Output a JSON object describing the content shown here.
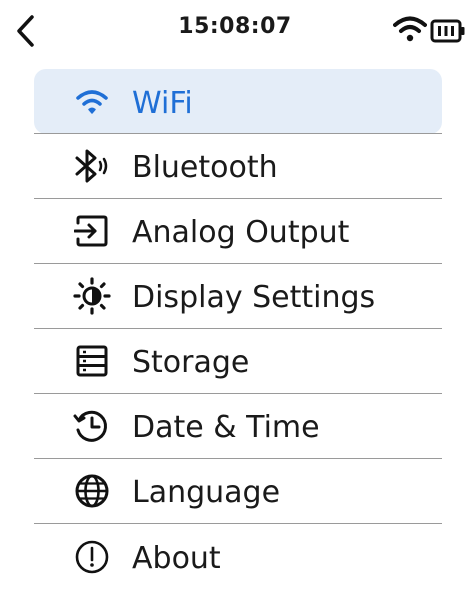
{
  "status_bar": {
    "time": "15:08:07",
    "back_icon": "chevron-left-icon",
    "wifi_icon": "wifi-icon",
    "battery_icon": "battery-icon"
  },
  "accent_color": "#1f6fd6",
  "selected_bg": "#e4edf8",
  "menu": {
    "items": [
      {
        "label": "WiFi",
        "icon": "wifi-icon",
        "selected": true
      },
      {
        "label": "Bluetooth",
        "icon": "bluetooth-icon",
        "selected": false
      },
      {
        "label": "Analog Output",
        "icon": "output-icon",
        "selected": false
      },
      {
        "label": "Display Settings",
        "icon": "brightness-icon",
        "selected": false
      },
      {
        "label": "Storage",
        "icon": "storage-icon",
        "selected": false
      },
      {
        "label": "Date & Time",
        "icon": "clock-icon",
        "selected": false
      },
      {
        "label": "Language",
        "icon": "globe-icon",
        "selected": false
      },
      {
        "label": "About",
        "icon": "info-icon",
        "selected": false
      }
    ]
  }
}
